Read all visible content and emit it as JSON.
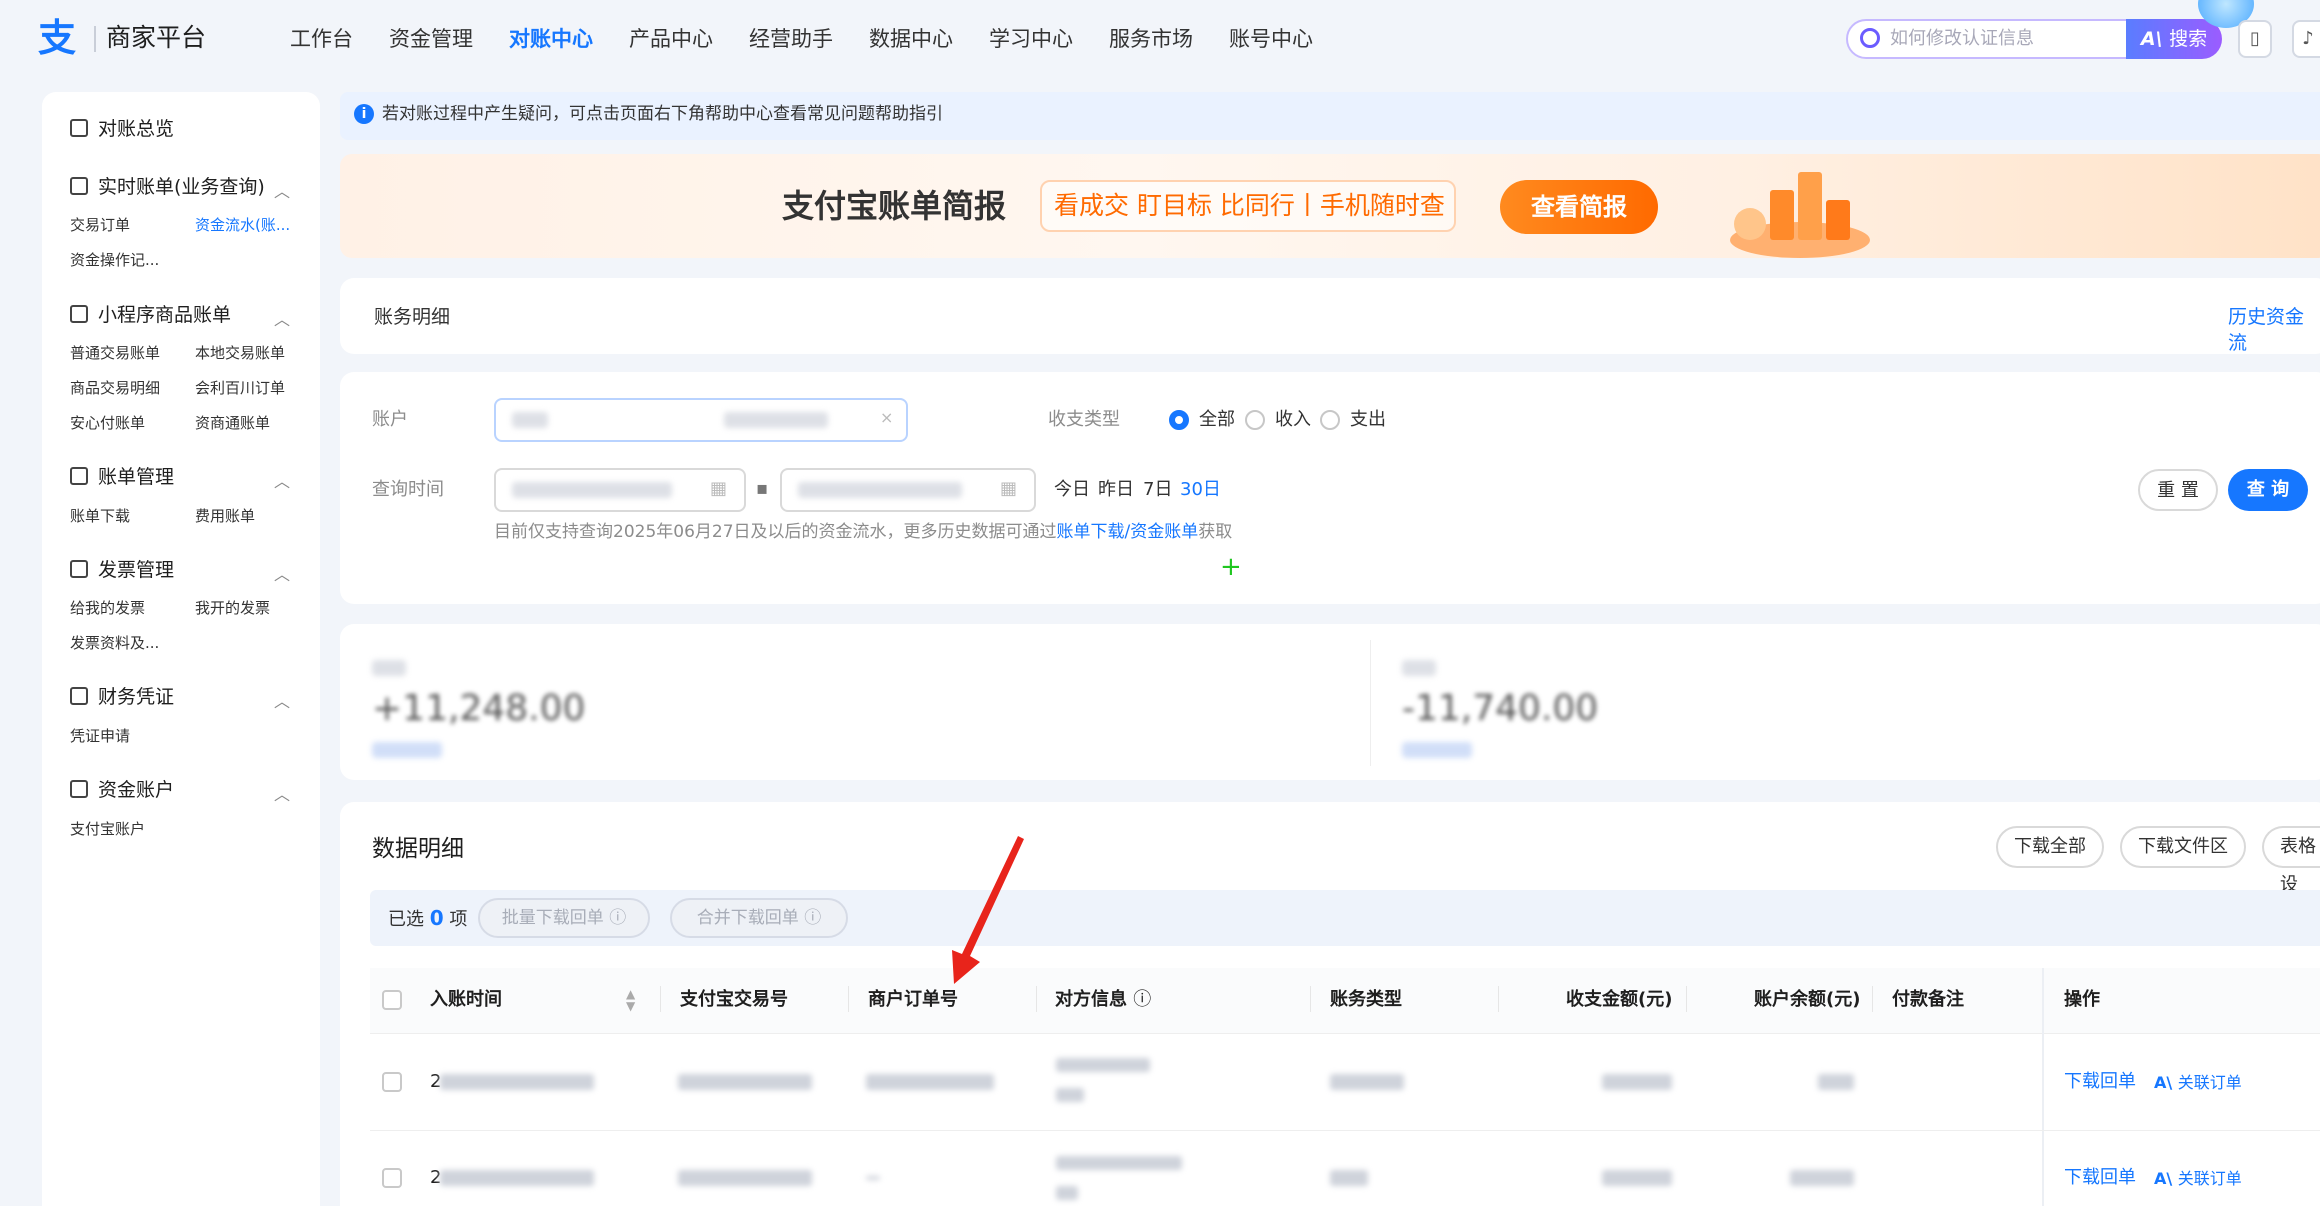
{
  "header": {
    "logo_text": "商家平台",
    "nav": [
      "工作台",
      "资金管理",
      "对账中心",
      "产品中心",
      "经营助手",
      "数据中心",
      "学习中心",
      "服务市场",
      "账号中心"
    ],
    "active_nav": "对账中心",
    "search_placeholder": "如何修改认证信息",
    "search_button": "搜索",
    "accent": "#1677ff"
  },
  "sidebar": {
    "overview": "对账总览",
    "groups": [
      {
        "title": "实时账单(业务查询)",
        "items": [
          "交易订单",
          "资金流水(账...",
          "资金操作记..."
        ]
      },
      {
        "title": "小程序商品账单",
        "items": [
          "普通交易账单",
          "本地交易账单",
          "商品交易明细",
          "会利百川订单",
          "安心付账单",
          "资商通账单"
        ]
      },
      {
        "title": "账单管理",
        "items": [
          "账单下载",
          "费用账单"
        ]
      },
      {
        "title": "发票管理",
        "items": [
          "给我的发票",
          "我开的发票",
          "发票资料及..."
        ]
      },
      {
        "title": "财务凭证",
        "items": [
          "凭证申请"
        ]
      },
      {
        "title": "资金账户",
        "items": [
          "支付宝账户"
        ]
      }
    ],
    "active_item": "资金流水(账..."
  },
  "notice": {
    "text": "若对账过程中产生疑问，可点击页面右下角帮助中心查看常见问题帮助指引"
  },
  "banner": {
    "title": "支付宝账单简报",
    "slogan": "看成交 盯目标 比同行丨手机随时查",
    "button": "查看简报"
  },
  "section": {
    "title": "账务明细",
    "history_link": "历史资金流"
  },
  "filter": {
    "account_label": "账户",
    "type_label": "收支类型",
    "type_options": [
      "全部",
      "收入",
      "支出"
    ],
    "type_selected": "全部",
    "time_label": "查询时间",
    "quick_ranges": [
      "今日",
      "昨日",
      "7日",
      "30日"
    ],
    "quick_selected": "30日",
    "reset": "重 置",
    "query": "查 询",
    "hint_prefix": "目前仅支持查询2025年06月27日及以后的资金流水，更多历史数据可通过",
    "hint_link": "账单下载/资金账单",
    "hint_suffix": "获取",
    "plus": "+"
  },
  "stats": {
    "income_value": "+11,248.00",
    "expense_value": "-11,740.00"
  },
  "data_table": {
    "title": "数据明细",
    "buttons": [
      "下载全部",
      "下载文件区",
      "表格设"
    ],
    "selected_prefix": "已选",
    "selected_count": "0",
    "selected_suffix": "项",
    "batch_download": "批量下载回单",
    "merge_download": "合并下载回单",
    "columns": [
      "入账时间",
      "支付宝交易号",
      "商户订单号",
      "对方信息",
      "账务类型",
      "收支金额(元)",
      "账户余额(元)",
      "付款备注",
      "操作"
    ],
    "rows": [
      {
        "time_prefix": "2",
        "op1": "下载回单",
        "op2": "关联订单"
      },
      {
        "time_prefix": "2",
        "op1": "下载回单",
        "op2": "关联订单"
      }
    ]
  }
}
